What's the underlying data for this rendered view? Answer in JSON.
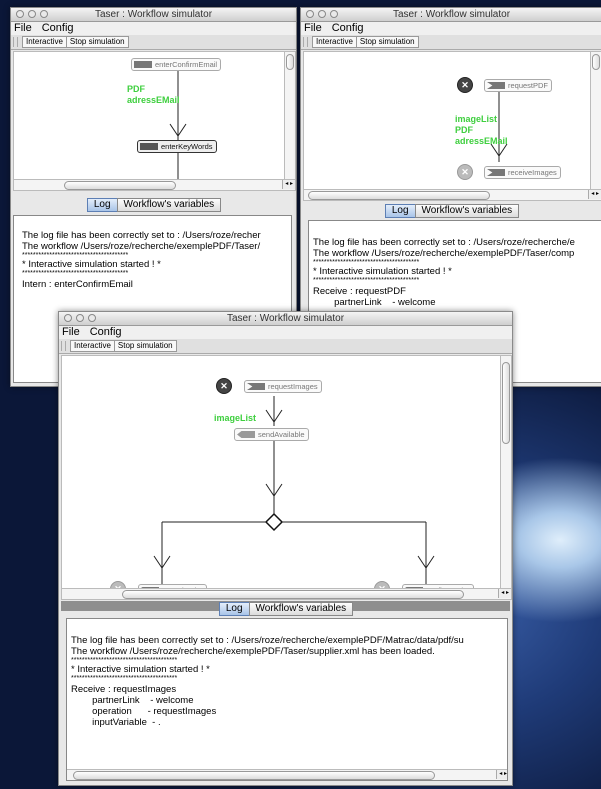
{
  "app": {
    "window_title": "Taser : Workflow simulator",
    "menu": [
      "File",
      "Config"
    ],
    "toolbar": {
      "interactive_label": "Interactive",
      "stop_label": "Stop simulation"
    },
    "tabs": {
      "log": "Log",
      "variables": "Workflow's variables"
    }
  },
  "window1": {
    "nodes": {
      "a": "enterConfirmEmail",
      "b": "enterKeyWords"
    },
    "green_labels": [
      "PDF",
      "adressEMail"
    ],
    "log_lines": [
      "The log file has been correctly set to : /Users/roze/recher",
      "The workflow /Users/roze/recherche/exemplePDF/Taser/",
      "***************************************",
      "* Interactive simulation started ! *",
      "***************************************",
      "Intern : enterConfirmEmail"
    ]
  },
  "window2": {
    "nodes": {
      "a": "requestPDF",
      "b": "receiveImages"
    },
    "green_labels": [
      "imageList",
      "PDF",
      "adressEMail"
    ],
    "log_lines": [
      "The log file has been correctly set to : /Users/roze/recherche/e",
      "The workflow /Users/roze/recherche/exemplePDF/Taser/comp",
      "***************************************",
      "* Interactive simulation started ! *",
      "***************************************",
      "Receive : requestPDF",
      "        partnerLink    - welcome"
    ]
  },
  "window3": {
    "nodes": {
      "a": "requestImages",
      "b": "sendAvailable",
      "c": "cancelOrder",
      "d": "confirmOrder"
    },
    "green_labels": [
      "imageList"
    ],
    "log_lines": [
      "The log file has been correctly set to : /Users/roze/recherche/exemplePDF/Matrac/data/pdf/su",
      "The workflow /Users/roze/recherche/exemplePDF/Taser/supplier.xml has been loaded.",
      "***************************************",
      "* Interactive simulation started ! *",
      "***************************************",
      "Receive : requestImages",
      "        partnerLink    - welcome",
      "        operation      - requestImages",
      "        inputVariable  - ."
    ]
  }
}
